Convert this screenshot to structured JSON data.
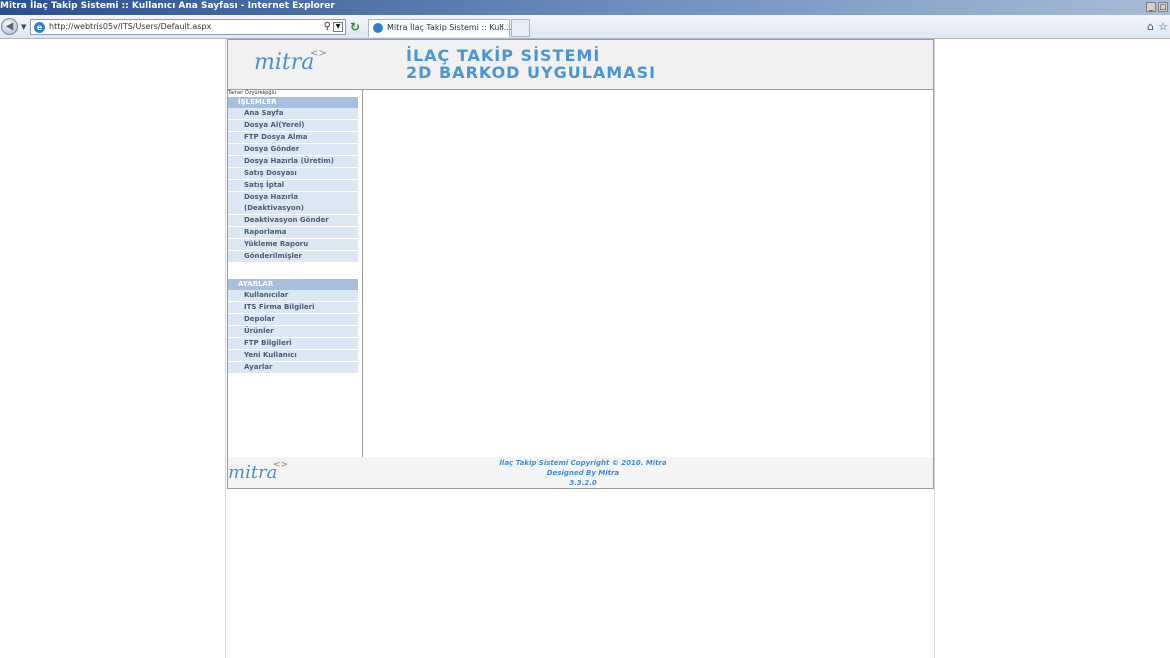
{
  "window": {
    "title": "Mitra İlaç Takip Sistemi :: Kullanıcı Ana Sayfası - Internet Explorer"
  },
  "browser": {
    "url": "http://webtris05v/ITS/Users/Default.aspx",
    "tab_title": "Mitra İlaç Takip Sistemi :: Kull...",
    "tab_close": "×"
  },
  "header": {
    "logo": "mitra",
    "logo_sup": "<>",
    "title_line1": "İLAÇ TAKİP SİSTEMİ",
    "title_line2": "2D BARKOD UYGULAMASI"
  },
  "sidebar": {
    "user": "Tamer Özyürekoğlu",
    "islemler": {
      "header": "İŞLEMLER",
      "items": [
        "Ana Sayfa",
        "Dosya Al(Yerel)",
        "FTP Dosya Alma",
        "Dosya Gönder",
        "Dosya Hazırla (Üretim)",
        "Satış Dosyası",
        "Satış İptal",
        "Dosya Hazırla (Deaktivasyon)",
        "Deaktivasyon Gönder",
        "Raporlama",
        "Yükleme Raporu",
        "Gönderilmişler"
      ]
    },
    "ayarlar": {
      "header": "AYARLAR",
      "items": [
        "Kullanıcılar",
        "ITS Firma Bilgileri",
        "Depolar",
        "Ürünler",
        "FTP Bilgileri",
        "Yeni Kullanıcı",
        "Ayarlar"
      ]
    }
  },
  "footer": {
    "logo": "mitra",
    "logo_sup": "<>",
    "line1": "İlaç Takip Sistemi   Copyright © 2010. Mitra",
    "line2": "Designed By  Mitra",
    "version": "3.3.2.0"
  },
  "colors": {
    "accent": "#4a95d6",
    "menu_header": "#a5bfdc",
    "menu_item_bg": "#dbe7f3"
  }
}
